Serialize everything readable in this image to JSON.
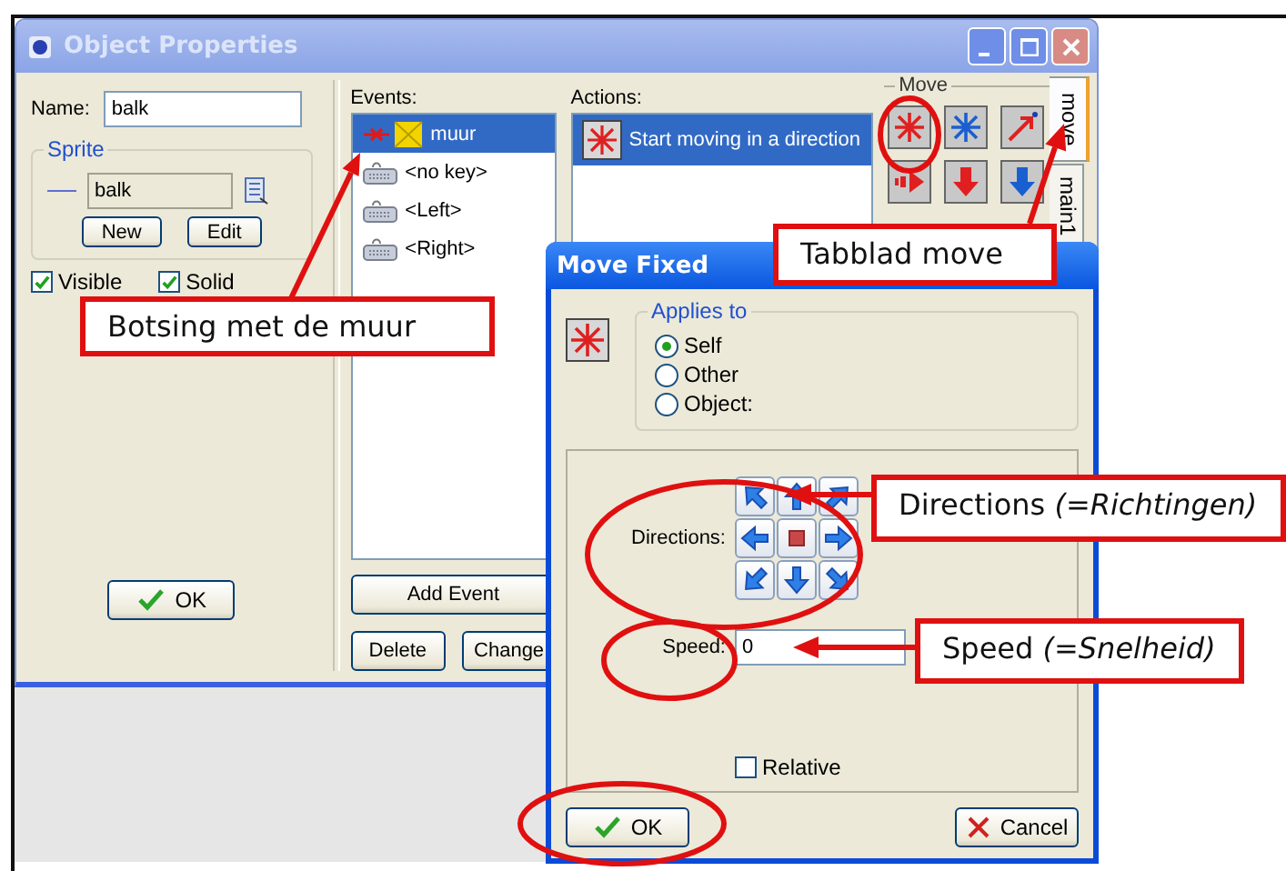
{
  "window": {
    "title": "Object Properties"
  },
  "name_field": {
    "label": "Name:",
    "value": "balk"
  },
  "sprite": {
    "title": "Sprite",
    "value": "balk",
    "buttons": [
      "New",
      "Edit"
    ]
  },
  "options": [
    {
      "label": "Visible",
      "checked": true
    },
    {
      "label": "Solid",
      "checked": true
    }
  ],
  "ok_button": "OK",
  "events": {
    "label": "Events:",
    "items": [
      {
        "label": "muur",
        "kind": "collision",
        "selected": true
      },
      {
        "label": "<no key>",
        "kind": "keyboard",
        "selected": false
      },
      {
        "label": "<Left>",
        "kind": "keyboard",
        "selected": false
      },
      {
        "label": "<Right>",
        "kind": "keyboard",
        "selected": false
      }
    ],
    "buttons": [
      "Add Event",
      "Delete",
      "Change"
    ]
  },
  "actions": {
    "label": "Actions:",
    "items": [
      {
        "label": "Start moving in a direction",
        "selected": true
      }
    ]
  },
  "palette": {
    "title": "Move"
  },
  "tabs": [
    {
      "label": "move",
      "selected": true
    },
    {
      "label": "main1",
      "selected": false
    }
  ],
  "dialog": {
    "title": "Move Fixed",
    "applies_to": {
      "title": "Applies to",
      "options": [
        {
          "label": "Self",
          "selected": true
        },
        {
          "label": "Other",
          "selected": false
        },
        {
          "label": "Object:",
          "selected": false
        }
      ]
    },
    "directions_label": "Directions:",
    "speed": {
      "label": "Speed:",
      "value": "0"
    },
    "relative": {
      "label": "Relative",
      "checked": false
    },
    "ok_button": "OK",
    "cancel_button": "Cancel"
  },
  "callouts": [
    {
      "text": "Botsing met de muur"
    },
    {
      "text": "Tabblad move"
    },
    {
      "text": "Directions *(=Richtingen)*"
    },
    {
      "text": "Speed *(=Snelheid)*"
    }
  ]
}
